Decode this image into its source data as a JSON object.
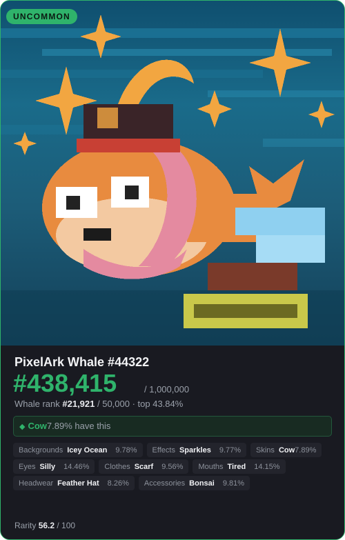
{
  "rarity_label": "UNCOMMON",
  "name": "PixelArk Whale #44322",
  "price": "#438,415",
  "supply": "/ 1,000,000",
  "rank": {
    "prefix": "Whale rank",
    "value": "#21,921",
    "suffix": "/ 50,000 · top 43.84%"
  },
  "rarest_trait": {
    "icon": "diamond-icon",
    "name": "Cow",
    "text": "7.89% have this"
  },
  "traits": [
    {
      "label": "Backgrounds",
      "value": "Icey Ocean",
      "pct": "9.78%"
    },
    {
      "label": "Effects",
      "value": "Sparkles",
      "pct": "9.77%"
    },
    {
      "label": "Skins",
      "value": "Cow",
      "pct": "7.89%"
    },
    {
      "label": "Eyes",
      "value": "Silly",
      "pct": "14.46%"
    },
    {
      "label": "Clothes",
      "value": "Scarf",
      "pct": "9.56%"
    },
    {
      "label": "Mouths",
      "value": "Tired",
      "pct": "14.15%"
    },
    {
      "label": "Headwear",
      "value": "Feather Hat",
      "pct": "8.26%"
    },
    {
      "label": "Accessories",
      "value": "Bonsai",
      "pct": "9.81%"
    }
  ],
  "rarity_score": {
    "label": "Rarity",
    "value": "56.2",
    "max": "/ 100"
  },
  "colors": {
    "accent": "#2fb36b",
    "card_bg": "#191a21",
    "chip_bg": "#23242c"
  }
}
